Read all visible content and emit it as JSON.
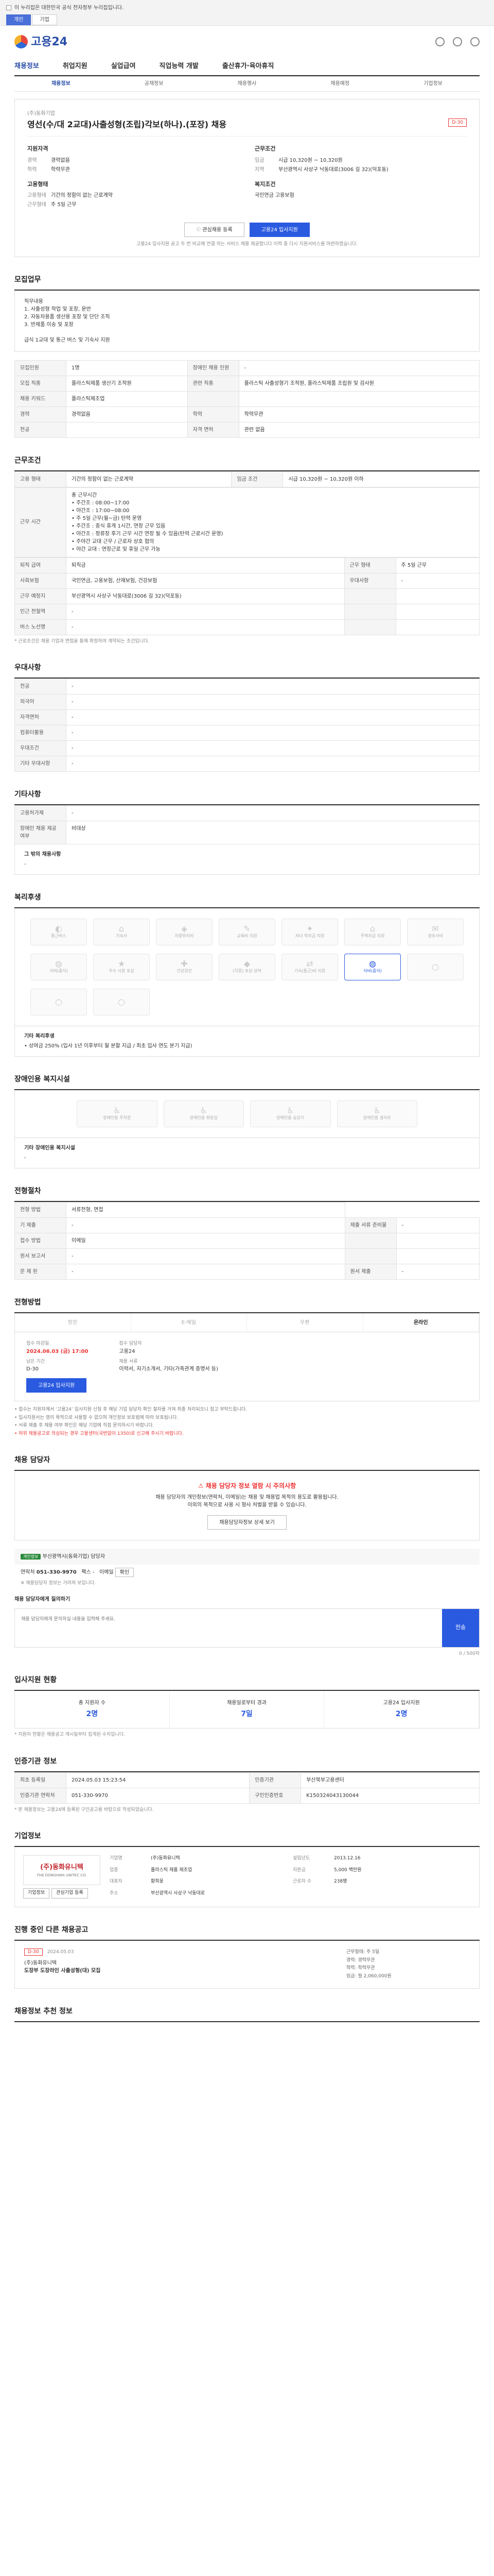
{
  "topbar": {
    "notice": "이 누리집은 대한민국 공식 전자정부 누리집입니다.",
    "tabs": [
      "개인",
      "기업"
    ]
  },
  "brand": {
    "name": "고용24"
  },
  "gnb": {
    "items": [
      "채용정보",
      "취업지원",
      "실업급여",
      "직업능력 개발",
      "출산휴가·육아휴직"
    ]
  },
  "subnav": {
    "items": [
      "채용정보",
      "공채정보",
      "채용행사",
      "채용예정",
      "기업정보"
    ]
  },
  "job": {
    "category": "(주)동화기업",
    "title": "영선(수/대 2교대)사출성형(조립)각보(하나).(포장) 채용",
    "dday": "D-30",
    "req_title": "지원자격",
    "req": [
      [
        "경력",
        "경력없음"
      ],
      [
        "학력",
        "학력무관"
      ]
    ],
    "cond_title": "근무조건",
    "cond": [
      [
        "임금",
        "시급 10,320원 ~ 10,320원"
      ],
      [
        "지역",
        "부산광역시 사상구 낙동대로(3006 길 32)(덕포동)"
      ]
    ],
    "form_title": "고용형태",
    "form": [
      [
        "고용형태",
        "기간의 정함이 없는 근로계약"
      ],
      [
        "근무형태",
        "주 5일 근무"
      ]
    ],
    "welfare_title": "복지조건",
    "welfare": "국민연금 고용보험",
    "scrap_label": "관심채용 등록",
    "apply_label": "고용24 입사지원",
    "notice": "고용24 입사지원 공고 두 번 비교해 연결 하는 서비스 채용 제공합니다 이력 중 다시 지원서비스를 마련하였습니다."
  },
  "duty": {
    "title": "모집업무",
    "mark": "상세보기",
    "body": "직무내용\n1. 사출성형 작업 및 포장, 운반\n2. 자동차용품 생산용 포장 및 단단 조직\n3. 반제품 이송 및 포장\n\n급식 1교대 및 통근 버스 및 기숙사 지원"
  },
  "recruit": {
    "rows": [
      [
        "모집인원",
        "1명",
        "장애인 채용 인원",
        "-"
      ],
      [
        "모집 직종",
        "플라스틱제품 생산기 조작원",
        "관련 직종",
        "플라스틱 사출성형기 조작원, 플라스틱제품 조립원 및 검사원"
      ],
      [
        "채용 키워드",
        "플라스틱제조업",
        "",
        ""
      ],
      [
        "경력",
        "경력없음",
        "학력",
        "학력무관"
      ],
      [
        "전공",
        "",
        "자격 면허",
        "관련 없음"
      ]
    ]
  },
  "work": {
    "title": "근무조건",
    "rows": [
      [
        "고용 형태",
        "기간의 정함이 없는 근로계약",
        "임금 조건",
        "시급 10,320원 ~ 10,320원 이하"
      ]
    ],
    "hours_label": "근무 시간",
    "hours": "총 근무시간\n• 주간조 : 08:00~17:00\n• 야간조 : 17:00~08:00\n• 주 5일 근무(월~금) 탄력 운영\n• 주간조 : 중식 휴게 1시간, 연장 근무 있음\n• 야간조 : 정류장 후기 근무 시간 연장 될 수 있음(탄력 근로시간 운영)\n• 주야간 교대 근무 / 근로자 상호 협의\n• 야간 교대 : 연장근로 및 휴일 근무 가능",
    "rows2": [
      [
        "퇴직 급여",
        "퇴직금",
        "근무 형태",
        "주 5일 근무"
      ],
      [
        "사회보험",
        "국민연금, 고용보험, 산재보험, 건강보험",
        "우대사항",
        "-"
      ],
      [
        "근무 예정지",
        "부산광역시 사상구 낙동대로(3006 길 32)(덕포동)",
        "",
        ""
      ],
      [
        "인근 전철역",
        "-",
        "",
        ""
      ],
      [
        "버스 노선명",
        "-",
        "",
        ""
      ]
    ],
    "notes": "* 근로조건은 채용 기업과 면접을 통해 확정하여 계약되는 조건입니다."
  },
  "pref": {
    "title": "우대사항",
    "rows": [
      [
        "전공",
        "-"
      ],
      [
        "외국어",
        "-"
      ],
      [
        "자격면허",
        "-"
      ],
      [
        "컴퓨터활용",
        "-"
      ],
      [
        "우대조건",
        "-"
      ],
      [
        "기타 우대사항",
        "-"
      ]
    ]
  },
  "etc": {
    "title": "기타사항",
    "rows": [
      [
        "고용허가제",
        "-"
      ],
      [
        "장애인 채용 제공 여부",
        "비대상"
      ]
    ],
    "more": "그 밖의 채용사항"
  },
  "welfare": {
    "title": "복리후생",
    "items": [
      "통근버스",
      "기숙사",
      "차량유지비",
      "교육비 지원",
      "자녀 학자금 지원",
      "주택자금 지원",
      "경조사비",
      "식비(중식)",
      "우수 사원 포상",
      "건강검진",
      "(각종) 포상·상여",
      "기숙(통근)비 지원",
      "식비(중식)",
      "",
      "",
      ""
    ],
    "active": 12,
    "sub_title": "기타 복리후생",
    "sub_body": "• 상여금 250% (입사 1년 이후부터 월 분할 지급 / 최초 입사 연도 분기 지급)"
  },
  "disabled": {
    "title": "장애인용 복지시설",
    "items": [
      "장애인용 주차장",
      "장애인용 화장실",
      "장애인용 승강기",
      "장애인용 경사로"
    ],
    "sub_title": "기타 장애인용 복지시설",
    "sub_body": "-"
  },
  "process": {
    "title": "전형절차",
    "rows": [
      [
        "전형 방법",
        "서류전형, 면접"
      ],
      [
        "기 제출",
        "-",
        "제출 서류 준비물",
        "-"
      ],
      [
        "접수 방법",
        "이메일",
        "",
        ""
      ],
      [
        "원서 보고서",
        "-",
        "",
        ""
      ],
      [
        "문 제 된",
        "-",
        "원서 제출",
        "-"
      ]
    ]
  },
  "apply": {
    "title": "전형방법",
    "tabs": [
      "방문",
      "E-메일",
      "우편",
      "온라인"
    ],
    "deadline_label": "접수 마감일",
    "deadline": "2024.06.03 (금) 17:00",
    "remain_label": "남은 기간",
    "remain": "D-30",
    "manager_label": "접수 담당자",
    "manager": "고용24",
    "online_label": "채용 서류",
    "online": "이력서, 자기소개서, 기타(가족관계 증명서 등)",
    "button": "고용24 입사지원",
    "bullets": [
      "• 접수는 지원자께서 ‘고용24’ 입사지원 신청 후 해당 기업 담당자 확인 절차를 거쳐 최종 처리되오니 참고 부탁드립니다.",
      "• 입사지원서는 영리 목적으로 사용할 수 없으며 개인정보 보호법에 따라 보호됩니다.",
      "• 서류 제출 후 채용 여부 확인은 해당 기업에 직접 문의하시기 바랍니다.",
      "• 허위 채용공고로 의심되는 경우 고용센터(국번없이 1350)로 신고해 주시기 바랍니다."
    ]
  },
  "ask": {
    "title": "채용 담당자",
    "warn_title": "채용 담당자 정보 열람 시 주의사항",
    "warn": "채용 담당자의 개인정보(연락처, 이메일)는 채용 및 채용업 목적의 용도로 활용됩니다.\n이외의 목적으로 사용 시 형사 처벌을 받을 수 있습니다.",
    "view_btn": "채용담당자정보 상세 보기",
    "tag": "개인정보",
    "company_label": "부산광역시(동화기업) 담당자",
    "contact_label": "연락처",
    "contact": "051-330-9970",
    "fax_label": "팩스",
    "fax": "-",
    "email_label": "이메일",
    "email": "확인",
    "masked": "※ 채용담당자 정보는 가려져 보입니다.",
    "form_label": "채용 담당자에게 질의하기",
    "placeholder": "채용 담당자에게 문의하실 내용을 입력해 주세요.",
    "counter": "0 / 500자",
    "send": "전송"
  },
  "stats": {
    "title": "입사지원 현황",
    "items": [
      [
        "총 지원자 수",
        "2명"
      ],
      [
        "채용일로부터 경과",
        "7일"
      ],
      [
        "고용24 입사지원",
        "2명"
      ]
    ],
    "note": "* 지원자 현황은 채용공고 게시일부터 집계된 수치입니다."
  },
  "inst": {
    "title": "인증기관 정보",
    "rows": [
      [
        "최초 등록일",
        "2024.05.03 15:23:54",
        "인증기관",
        "부산북부고용센터"
      ],
      [
        "인증기관 연락처",
        "051-330-9970",
        "구인인증번호",
        "K150324043130044"
      ]
    ],
    "notes": "* 본 채용정보는 고용24에 등록된 구인공고를 바탕으로 작성되었습니다."
  },
  "company": {
    "title": "기업정보",
    "logo_main": "(주)동화유니텍",
    "logo_sub": "THE DONGHWA UNITEC CO.",
    "rows": [
      [
        "기업명",
        "(주)동화유니텍",
        "설립년도",
        "2013.12.16"
      ],
      [
        "업종",
        "플라스틱 제품 제조업",
        "자본금",
        "5,000 백만원"
      ],
      [
        "대표자",
        "황희웅",
        "근로자 수",
        "238명"
      ],
      [
        "주소",
        "부산광역시 사상구 낙동대로",
        "",
        ""
      ]
    ],
    "btn1": "기업정보",
    "btn2": "관심기업 등록"
  },
  "related": {
    "title": "진행 중인 다른 채용공고",
    "dday": "D-30",
    "date": "2024.05.03",
    "name": "(주)동화유니텍",
    "job": "도장부 도장라인 사출성형(대) 모집",
    "right": [
      "근무형태: 주 5일",
      "경력: 경력무관",
      "학력: 학력무관",
      "임금: 월 2,060,000원"
    ]
  },
  "recommend": {
    "title": "채용정보 추천 정보"
  }
}
